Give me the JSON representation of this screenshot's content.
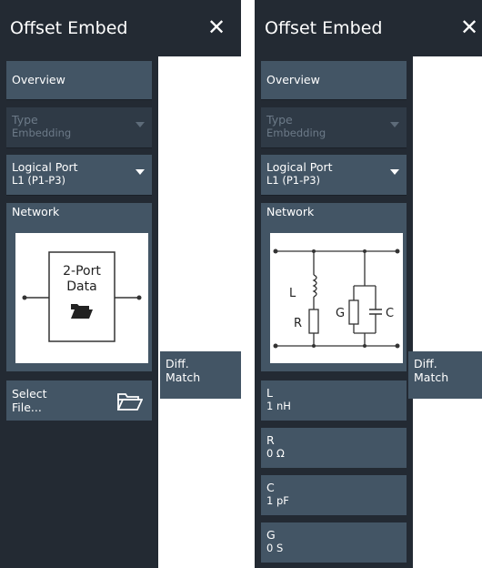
{
  "left_panel": {
    "title": "Offset Embed",
    "close_icon": "close-icon",
    "overview_label": "Overview",
    "type_label": "Type",
    "type_value": "Embedding",
    "logical_port_label": "Logical Port",
    "logical_port_value": "L1 (P1-P3)",
    "network_label": "Network",
    "diagram_text_line1": "2-Port",
    "diagram_text_line2": "Data",
    "select_file_line1": "Select",
    "select_file_line2": "File...",
    "folder_icon": "folder-open-icon",
    "diff_line1": "Diff.",
    "diff_line2": "Match"
  },
  "right_panel": {
    "title": "Offset Embed",
    "close_icon": "close-icon",
    "overview_label": "Overview",
    "type_label": "Type",
    "type_value": "Embedding",
    "logical_port_label": "Logical Port",
    "logical_port_value": "L1 (P1-P3)",
    "network_label": "Network",
    "circuit_labels": {
      "L": "L",
      "R": "R",
      "G": "G",
      "C": "C"
    },
    "diff_line1": "Diff.",
    "diff_line2": "Match",
    "params": [
      {
        "label": "L",
        "value": "1 nH"
      },
      {
        "label": "R",
        "value": "0 Ω"
      },
      {
        "label": "C",
        "value": "1 pF"
      },
      {
        "label": "G",
        "value": "0 S"
      }
    ]
  },
  "colors": {
    "panel_bg": "#232a33",
    "button_bg": "#435565",
    "disabled_text": "#6c7a88"
  }
}
